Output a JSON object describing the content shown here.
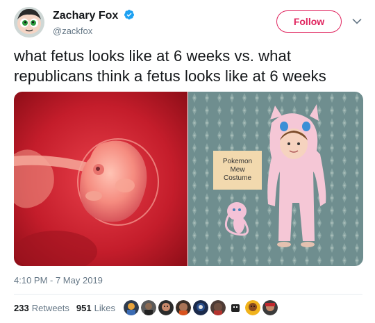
{
  "author": {
    "display_name": "Zachary Fox",
    "handle": "@zackfox",
    "verified_icon": "verified-badge-icon",
    "avatar_icon": "powerpuff-avatar"
  },
  "follow_button": {
    "label": "Follow",
    "color": "#e0245e"
  },
  "menu_icon": "chevron-down-icon",
  "tweet": {
    "text": "what fetus looks like at 6 weeks vs. what republicans think a fetus looks like at 6 weeks",
    "timestamp": "4:10 PM - 7 May 2019"
  },
  "media": {
    "left_image": "fetus-6-weeks-image",
    "right_image": "child-in-pokemon-costume-image",
    "sign_text": [
      "Pokemon",
      "Mew",
      "Costume"
    ]
  },
  "stats": {
    "retweets_count": "233",
    "retweets_label": "Retweets",
    "likes_count": "951",
    "likes_label": "Likes"
  },
  "likers": [
    "liker-avatar",
    "liker-avatar",
    "liker-avatar",
    "liker-avatar",
    "liker-avatar",
    "liker-avatar",
    "liker-avatar",
    "liker-avatar",
    "liker-avatar"
  ],
  "colors": {
    "text_primary": "#14171a",
    "text_secondary": "#657786",
    "verified": "#1da1f2",
    "divider": "#e6ecf0"
  }
}
